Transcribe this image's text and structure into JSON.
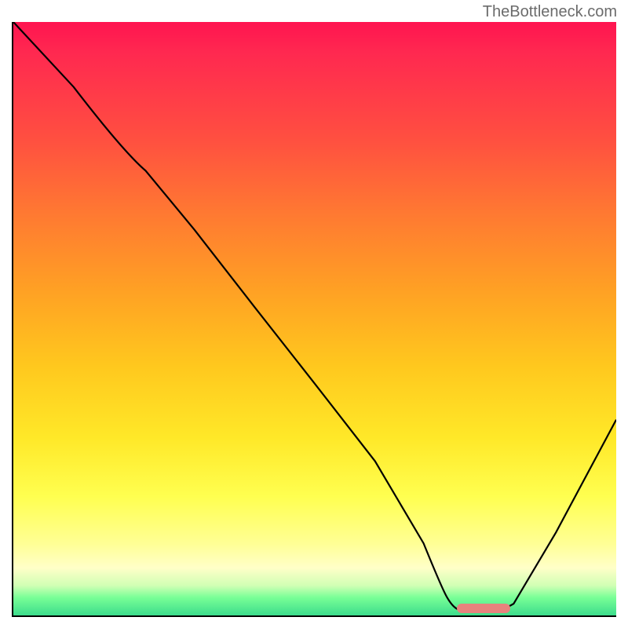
{
  "watermark": "TheBottleneck.com",
  "chart_data": {
    "type": "line",
    "title": "",
    "xlabel": "",
    "ylabel": "",
    "xlim": [
      0,
      100
    ],
    "ylim": [
      0,
      100
    ],
    "x": [
      0,
      10,
      22,
      30,
      40,
      50,
      60,
      68,
      72,
      78,
      83,
      90,
      100
    ],
    "values": [
      100,
      89,
      75,
      65,
      52,
      39,
      26,
      12,
      3,
      0.5,
      2,
      14,
      33
    ],
    "marker": {
      "x_start": 73,
      "x_end": 82,
      "y": 0.5
    },
    "background_gradient": {
      "top": "#ff1450",
      "upper_mid": "#ff7832",
      "mid": "#ffc81e",
      "lower_mid": "#ffff50",
      "bottom": "#3cdc8c"
    }
  }
}
